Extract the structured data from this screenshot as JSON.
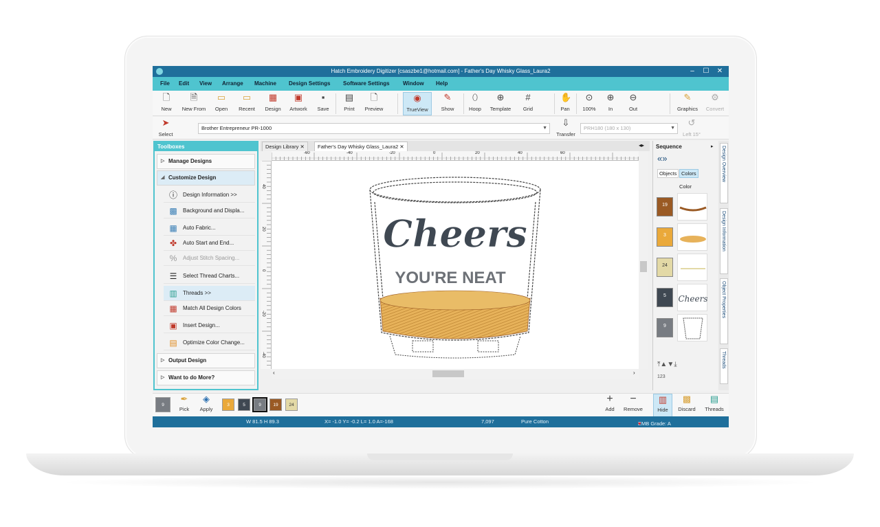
{
  "window": {
    "title": "Hatch Embroidery Digitizer [csaszbe1@hotmail.com] - Father's Day Whisky Glass_Laura2",
    "controls": [
      "–",
      "☐",
      "✕"
    ]
  },
  "menu": [
    "File",
    "Edit",
    "View",
    "Arrange",
    "Machine",
    "Design Settings",
    "Software Settings",
    "Window",
    "Help"
  ],
  "toolbar": {
    "tools": [
      {
        "label": "New",
        "icon": "new-file-icon"
      },
      {
        "label": "New From",
        "icon": "new-from-template-icon"
      },
      {
        "label": "Open",
        "icon": "folder-open-icon"
      },
      {
        "label": "Recent",
        "icon": "recent-folder-icon"
      },
      {
        "label": "Design",
        "icon": "design-icon"
      },
      {
        "label": "Artwork",
        "icon": "artwork-icon"
      },
      {
        "label": "Save",
        "icon": "save-icon"
      },
      {
        "label": "Print",
        "icon": "print-icon"
      },
      {
        "label": "Preview",
        "icon": "preview-icon"
      },
      {
        "label": "TrueView",
        "icon": "trueview-eye-icon"
      },
      {
        "label": "Show",
        "icon": "show-icon"
      },
      {
        "label": "Hoop",
        "icon": "hoop-icon"
      },
      {
        "label": "Template",
        "icon": "template-icon"
      },
      {
        "label": "Grid",
        "icon": "grid-icon"
      },
      {
        "label": "Pan",
        "icon": "pan-hand-icon"
      },
      {
        "label": "100%",
        "icon": "zoom-100-icon"
      },
      {
        "label": "In",
        "icon": "zoom-in-icon"
      },
      {
        "label": "Out",
        "icon": "zoom-out-icon"
      },
      {
        "label": "Graphics",
        "icon": "graphics-pencil-icon"
      },
      {
        "label": "Convert",
        "icon": "convert-icon"
      }
    ]
  },
  "toolbar2": {
    "select_label": "Select",
    "machine": "Brother Entrepreneur PR-1000",
    "transfer_label": "Transfer",
    "hoop": "PRH180 (180 x 130)",
    "left_label": "Left 15°"
  },
  "toolboxes": {
    "title": "Toolboxes",
    "groups": {
      "manage": "Manage Designs",
      "customize": "Customize Design",
      "output": "Output Design",
      "more": "Want to do More?"
    },
    "customize_tools": [
      {
        "label": "Design Information >>",
        "icon": "info-icon"
      },
      {
        "label": "Background and Displa...",
        "icon": "background-icon"
      },
      {
        "label": "Auto Fabric...",
        "icon": "auto-fabric-icon"
      },
      {
        "label": "Auto Start and End...",
        "icon": "auto-start-end-icon"
      },
      {
        "label": "Adjust Stitch Spacing...",
        "icon": "stitch-spacing-icon"
      },
      {
        "label": "Select Thread Charts...",
        "icon": "thread-chart-icon"
      },
      {
        "label": "Threads >>",
        "icon": "threads-icon"
      },
      {
        "label": "Match All Design Colors",
        "icon": "match-colors-icon"
      },
      {
        "label": "Insert Design...",
        "icon": "insert-design-icon"
      },
      {
        "label": "Optimize Color Change...",
        "icon": "optimize-color-icon"
      }
    ]
  },
  "tabs": {
    "library": "Design Library",
    "design": "Father's Day Whisky Glass_Laura2"
  },
  "ruler": {
    "h_labels": [
      "-60",
      "-40",
      "-20",
      "0",
      "20",
      "40",
      "60"
    ],
    "v_labels": [
      "40",
      "20",
      "0",
      "-20",
      "-40"
    ]
  },
  "design": {
    "headline": "Cheers",
    "subline": "YOU'RE NEAT"
  },
  "sequence": {
    "title": "Sequence",
    "tabs": [
      "Objects",
      "Colors"
    ],
    "column_label": "Color",
    "rows": [
      {
        "number": "19",
        "color": "#9a5a24",
        "thumb": "rim"
      },
      {
        "number": "3",
        "color": "#eaa93a",
        "thumb": "liquid"
      },
      {
        "number": "24",
        "color": "#e3d9a6",
        "thumb": "highlight"
      },
      {
        "number": "5",
        "color": "#3f4852",
        "thumb": "cheers"
      },
      {
        "number": "9",
        "color": "#787c82",
        "thumb": "glass"
      }
    ],
    "footer_label": "123"
  },
  "side_tabs": [
    "Design Overview",
    "Design Information",
    "Object Properties",
    "Threads"
  ],
  "colorbar": {
    "current": "9",
    "pick": "Pick",
    "apply": "Apply",
    "chips": [
      {
        "number": "3",
        "color": "#eaa93a"
      },
      {
        "number": "5",
        "color": "#3f4852"
      },
      {
        "number": "9",
        "color": "#787c82"
      },
      {
        "number": "19",
        "color": "#9a5a24"
      },
      {
        "number": "24",
        "color": "#e3d9a6"
      }
    ],
    "add": "Add",
    "remove": "Remove",
    "hide": "Hide",
    "discard": "Discard",
    "threads": "Threads"
  },
  "status": {
    "size": "W 81.5 H 89.3",
    "coords": "X= -1.0 Y= -0.2 L= 1.0 A=-168",
    "stitches": "7,097",
    "fabric": "Pure Cotton",
    "grade": "EMB Grade: A"
  }
}
